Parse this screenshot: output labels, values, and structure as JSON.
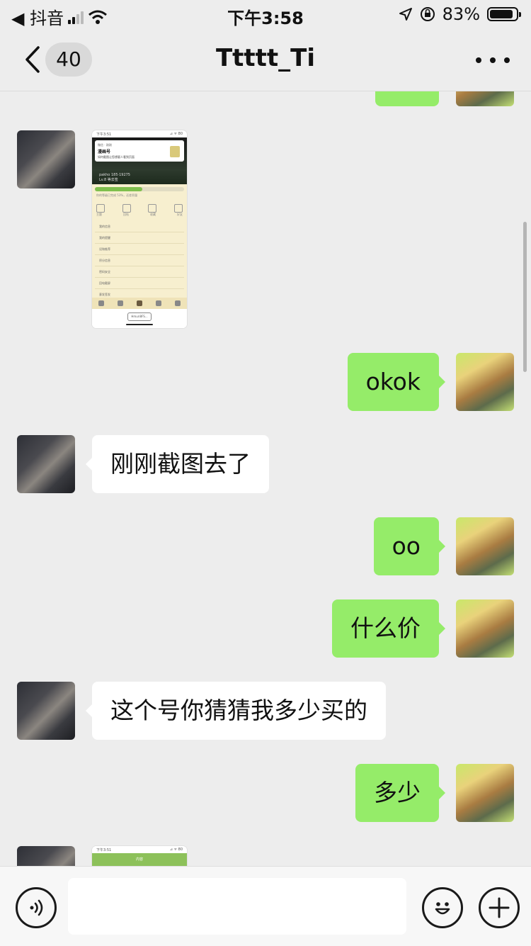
{
  "status_bar": {
    "back_app": "◀ 抖音",
    "time": "下午3:58",
    "battery": "83%",
    "icons": [
      "signal-icon",
      "wifi-icon",
      "location-icon",
      "orientation-lock-icon",
      "battery-icon"
    ]
  },
  "header": {
    "back_icon": "chevron-left-icon",
    "unread_count": "40",
    "title": "Ttttt_Ti",
    "more_icon": "ellipsis-icon"
  },
  "colors": {
    "background": "#ededed",
    "my_bubble": "#95ec69",
    "their_bubble": "#ffffff"
  },
  "messages": [
    {
      "sender": "me",
      "type": "text",
      "text": "",
      "partial": true
    },
    {
      "sender": "them",
      "type": "image",
      "description_text": {
        "status_time": "下午3:51",
        "status_right": "⊿ ᯤ 80",
        "card_source": "微信 · 刚刚",
        "card_title": "漫画号",
        "card_text": "如何截图让您想要人看到页面",
        "user_line1": "pakho 185·19275",
        "user_line2": "Lv.8  等去签",
        "progress_text": "你的等级已完成 53%，还差积量",
        "progress_fraction": 0.53,
        "tabs": [
          "主题",
          "回帖",
          "收藏",
          "好友"
        ],
        "rows": [
          "我的信息",
          "我的提醒",
          "设和推荐",
          "积分信息",
          "密码安全",
          "回电截屏",
          "意发签发"
        ],
        "url": "Hmuri8FS..."
      }
    },
    {
      "sender": "me",
      "type": "text",
      "text": "okok"
    },
    {
      "sender": "them",
      "type": "text",
      "text": "刚刚截图去了"
    },
    {
      "sender": "me",
      "type": "text",
      "text": "oo"
    },
    {
      "sender": "me",
      "type": "text",
      "text": "什么价"
    },
    {
      "sender": "them",
      "type": "text",
      "text": "这个号你猜猜我多少买的"
    },
    {
      "sender": "me",
      "type": "text",
      "text": "多少"
    },
    {
      "sender": "them",
      "type": "image",
      "partial": true,
      "description_text": {
        "status_time": "下午3:51",
        "status_right": "⊿ ᯤ 80",
        "bar_title": "内容"
      }
    }
  ],
  "input_bar": {
    "voice_icon": "voice-icon",
    "input_value": "",
    "emoji_icon": "emoji-icon",
    "plus_icon": "plus-icon"
  }
}
